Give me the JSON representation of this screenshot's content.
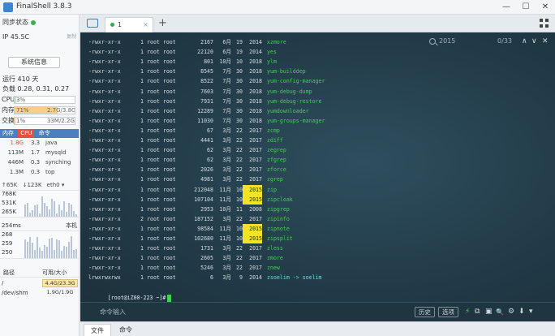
{
  "app": {
    "title": "FinalShell 3.8.3",
    "minimize": "—",
    "maximize": "☐",
    "close": "✕"
  },
  "sidebar": {
    "sync_status": "同步状态",
    "ip": "IP 45.5C",
    "copy": "复制",
    "sysinfo_button": "系统信息",
    "uptime": "运行 410 天",
    "load": "负载 0.28, 0.31, 0.27",
    "cpu": {
      "label": "CPU",
      "value": "3%",
      "percent": 3
    },
    "mem": {
      "label": "内存",
      "percent_text": "71%",
      "value": "2.7G/3.8G",
      "percent": 71
    },
    "swap": {
      "label": "交换",
      "percent_text": "1%",
      "value": "33M/2.2G",
      "percent": 1
    },
    "proc_tabs": [
      "内存",
      "CPU",
      "命令"
    ],
    "processes": [
      {
        "mem": "1.8G",
        "cpu": "3.3",
        "cmd": "java"
      },
      {
        "mem": "113M",
        "cpu": "1.7",
        "cmd": "mysqld"
      },
      {
        "mem": "446M",
        "cpu": "0.3",
        "cmd": "synching"
      },
      {
        "mem": "1.3M",
        "cpu": "0.3",
        "cmd": "top"
      }
    ],
    "net": {
      "up": "↑65K",
      "down": "↓123K",
      "iface": "eth0 ▾"
    },
    "net_ticks": [
      "768K",
      "531K",
      "265K"
    ],
    "latency": {
      "label": "254ms",
      "host": "本机",
      "ticks": [
        "268",
        "259",
        "250"
      ]
    },
    "disk_head": {
      "path": "路径",
      "size": "可用/大小"
    },
    "disks": [
      {
        "path": "/",
        "value": "4.4G/23.3G"
      },
      {
        "path": "/dev/shm",
        "value": "1.9G/1.9G"
      }
    ]
  },
  "tabs": {
    "tab_label": "1",
    "close": "×",
    "add": "+"
  },
  "search": {
    "query": "2015",
    "count": "0/33",
    "prev": "∧",
    "next": "∨",
    "close": "✕"
  },
  "terminal": {
    "lines": [
      {
        "perm": "-rwxr-xr-x",
        "links": "1",
        "owner": "root root",
        "size": "2167",
        "month": "6月",
        "day": "19",
        "year": "2014",
        "name": "xzmore"
      },
      {
        "perm": "-rwxr-xr-x",
        "links": "1",
        "owner": "root root",
        "size": "22120",
        "month": "6月",
        "day": "19",
        "year": "2014",
        "name": "yes"
      },
      {
        "perm": "-rwxr-xr-x",
        "links": "1",
        "owner": "root root",
        "size": "801",
        "month": "10月",
        "day": "10",
        "year": "2018",
        "name": "ylm"
      },
      {
        "perm": "-rwxr-xr-x",
        "links": "1",
        "owner": "root root",
        "size": "8545",
        "month": "7月",
        "day": "30",
        "year": "2018",
        "name": "yum-builddep"
      },
      {
        "perm": "-rwxr-xr-x",
        "links": "1",
        "owner": "root root",
        "size": "8522",
        "month": "7月",
        "day": "30",
        "year": "2018",
        "name": "yum-config-manager"
      },
      {
        "perm": "-rwxr-xr-x",
        "links": "1",
        "owner": "root root",
        "size": "7603",
        "month": "7月",
        "day": "30",
        "year": "2018",
        "name": "yum-debug-dump"
      },
      {
        "perm": "-rwxr-xr-x",
        "links": "1",
        "owner": "root root",
        "size": "7931",
        "month": "7月",
        "day": "30",
        "year": "2018",
        "name": "yum-debug-restore"
      },
      {
        "perm": "-rwxr-xr-x",
        "links": "1",
        "owner": "root root",
        "size": "12289",
        "month": "7月",
        "day": "30",
        "year": "2018",
        "name": "yumdownloader"
      },
      {
        "perm": "-rwxr-xr-x",
        "links": "1",
        "owner": "root root",
        "size": "11030",
        "month": "7月",
        "day": "30",
        "year": "2018",
        "name": "yum-groups-manager"
      },
      {
        "perm": "-rwxr-xr-x",
        "links": "1",
        "owner": "root root",
        "size": "67",
        "month": "3月",
        "day": "22",
        "year": "2017",
        "name": "zcmp"
      },
      {
        "perm": "-rwxr-xr-x",
        "links": "1",
        "owner": "root root",
        "size": "4441",
        "month": "3月",
        "day": "22",
        "year": "2017",
        "name": "zdiff"
      },
      {
        "perm": "-rwxr-xr-x",
        "links": "1",
        "owner": "root root",
        "size": "62",
        "month": "3月",
        "day": "22",
        "year": "2017",
        "name": "zegrep"
      },
      {
        "perm": "-rwxr-xr-x",
        "links": "1",
        "owner": "root root",
        "size": "62",
        "month": "3月",
        "day": "22",
        "year": "2017",
        "name": "zfgrep"
      },
      {
        "perm": "-rwxr-xr-x",
        "links": "1",
        "owner": "root root",
        "size": "2026",
        "month": "3月",
        "day": "22",
        "year": "2017",
        "name": "zforce"
      },
      {
        "perm": "-rwxr-xr-x",
        "links": "1",
        "owner": "root root",
        "size": "4981",
        "month": "3月",
        "day": "22",
        "year": "2017",
        "name": "zgrep"
      },
      {
        "perm": "-rwxr-xr-x",
        "links": "1",
        "owner": "root root",
        "size": "212048",
        "month": "11月",
        "day": "10",
        "year": "2015",
        "name": "zip",
        "hl": true
      },
      {
        "perm": "-rwxr-xr-x",
        "links": "1",
        "owner": "root root",
        "size": "107104",
        "month": "11月",
        "day": "10",
        "year": "2015",
        "name": "zipcloak",
        "hl": true
      },
      {
        "perm": "-rwxr-xr-x",
        "links": "1",
        "owner": "root root",
        "size": "2953",
        "month": "10月",
        "day": "11",
        "year": "2008",
        "name": "zipgrep"
      },
      {
        "perm": "-rwxr-xr-x",
        "links": "2",
        "owner": "root root",
        "size": "187152",
        "month": "3月",
        "day": "22",
        "year": "2017",
        "name": "zipinfo"
      },
      {
        "perm": "-rwxr-xr-x",
        "links": "1",
        "owner": "root root",
        "size": "98584",
        "month": "11月",
        "day": "10",
        "year": "2015",
        "name": "zipnote",
        "hl": true
      },
      {
        "perm": "-rwxr-xr-x",
        "links": "1",
        "owner": "root root",
        "size": "102680",
        "month": "11月",
        "day": "10",
        "year": "2015",
        "name": "zipsplit",
        "hl": true
      },
      {
        "perm": "-rwxr-xr-x",
        "links": "1",
        "owner": "root root",
        "size": "1731",
        "month": "3月",
        "day": "22",
        "year": "2017",
        "name": "zless"
      },
      {
        "perm": "-rwxr-xr-x",
        "links": "1",
        "owner": "root root",
        "size": "2605",
        "month": "3月",
        "day": "22",
        "year": "2017",
        "name": "zmore"
      },
      {
        "perm": "-rwxr-xr-x",
        "links": "1",
        "owner": "root root",
        "size": "5246",
        "month": "3月",
        "day": "22",
        "year": "2017",
        "name": "znew"
      },
      {
        "perm": "lrwxrwxrwx",
        "links": "1",
        "owner": "root root",
        "size": "6",
        "month": "3月",
        "day": "9",
        "year": "2014",
        "name": "zsoelim -> soelim",
        "link": true
      }
    ],
    "prompt": "[root@iZ00-223 ~]#"
  },
  "cmdbar": {
    "placeholder": "命令输入",
    "history": "历史",
    "options": "选项",
    "icons": [
      "⚡",
      "⧉",
      "▣",
      "🔍",
      "⚙",
      "⬇",
      "▾"
    ]
  },
  "bottom_tabs": [
    "文件",
    "命令"
  ],
  "colors": {
    "accent": "#4a7fc1",
    "highlight": "#f2e22a",
    "green": "#3fd34f",
    "terminal_bg": "#223b48"
  }
}
